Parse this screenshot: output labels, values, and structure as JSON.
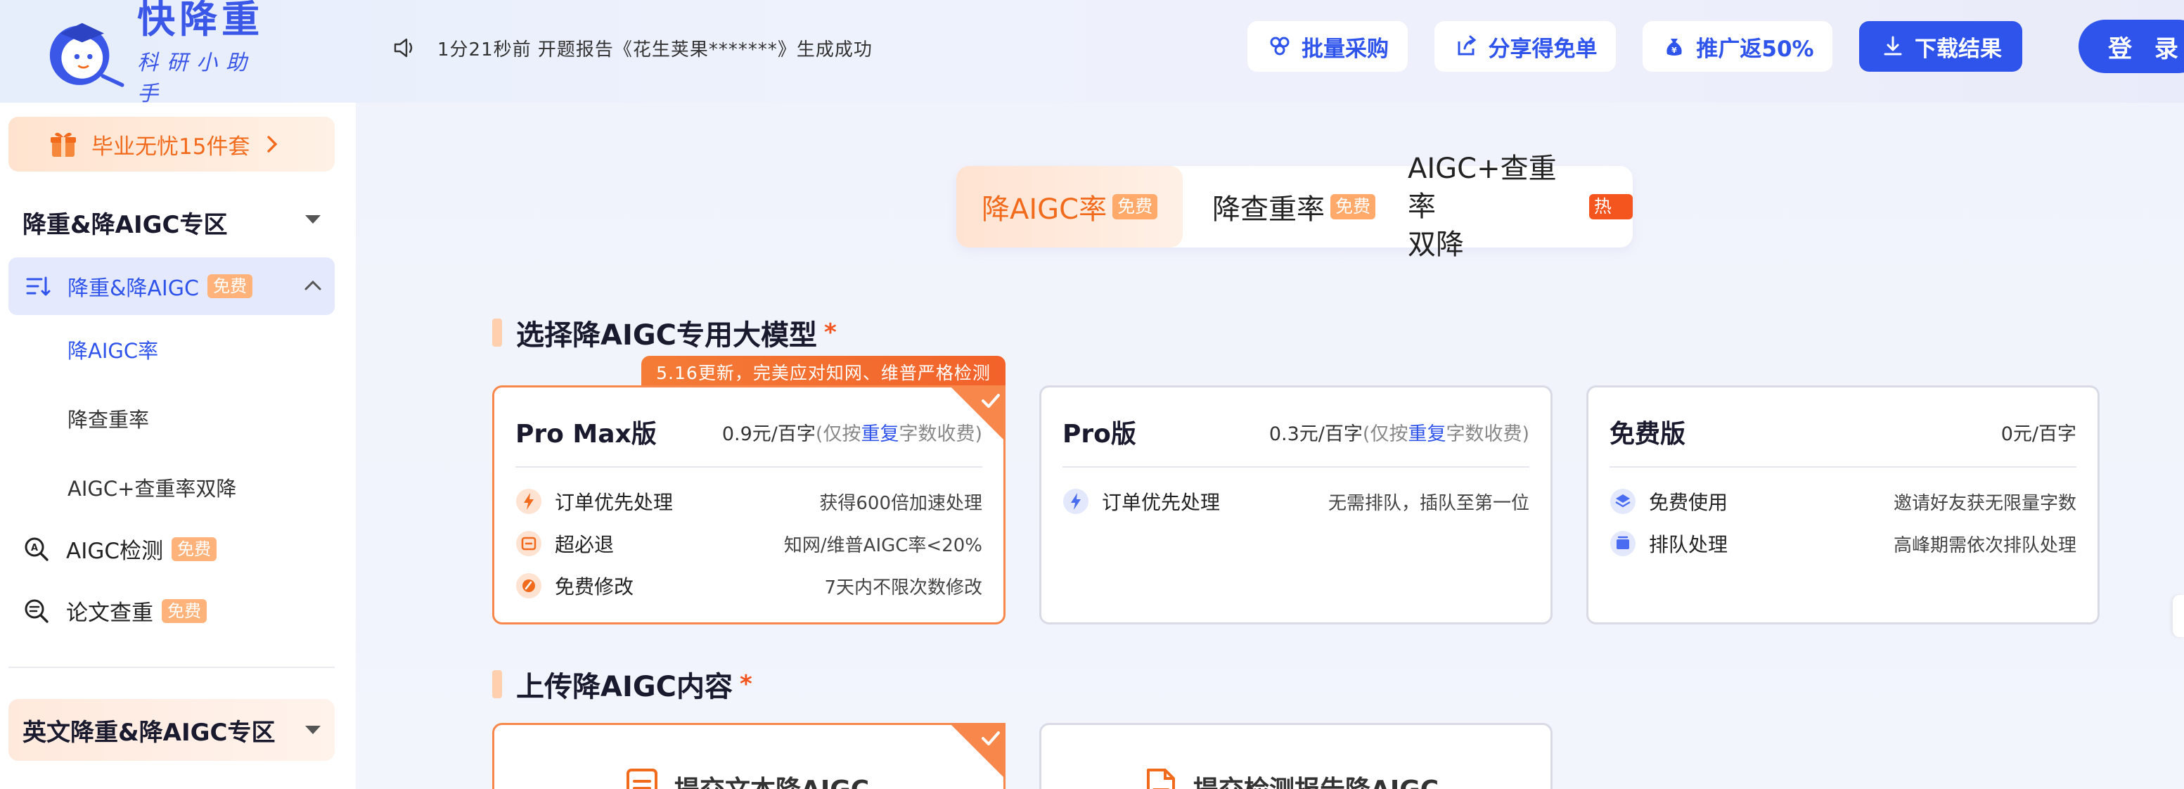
{
  "header": {
    "logo": {
      "title": "快降重",
      "subtitle": "科研小助手"
    },
    "notice": "1分21秒前 开题报告《花生荚果*******》生成成功",
    "buttons": {
      "bulk": "批量采购",
      "share": "分享得免单",
      "promote": "推广返50%",
      "download": "下载结果"
    },
    "login": "登 录"
  },
  "sidebar": {
    "promo": "毕业无忧15件套",
    "group1": "降重&降AIGC专区",
    "active_item": {
      "label": "降重&降AIGC",
      "badge": "免费"
    },
    "sub_items": [
      "降AIGC率",
      "降查重率",
      "AIGC+查重率双降"
    ],
    "items": [
      {
        "label": "AIGC检测",
        "badge": "免费"
      },
      {
        "label": "论文查重",
        "badge": "免费"
      }
    ],
    "group2": "英文降重&降AIGC专区"
  },
  "tabs": [
    {
      "label": "降AIGC率",
      "badge": "免费"
    },
    {
      "label": "降查重率",
      "badge": "免费"
    },
    {
      "label_line1": "AIGC+查重率",
      "label_line2": "双降",
      "badge": "热门"
    }
  ],
  "model_section": {
    "title": "选择降AIGC专用大模型",
    "required_mark": "*",
    "ribbon": "5.16更新，完美应对知网、维普严格检测",
    "cards": [
      {
        "name": "Pro Max版",
        "price": "0.9元/百字",
        "note_prefix": "(仅按",
        "note_em": "重复",
        "note_suffix": "字数收费)",
        "features": [
          {
            "label": "订单优先处理",
            "value": "获得600倍加速处理"
          },
          {
            "label": "超必退",
            "value": "知网/维普AIGC率<20%"
          },
          {
            "label": "免费修改",
            "value": "7天内不限次数修改"
          }
        ]
      },
      {
        "name": "Pro版",
        "price": "0.3元/百字",
        "note_prefix": "(仅按",
        "note_em": "重复",
        "note_suffix": "字数收费)",
        "features": [
          {
            "label": "订单优先处理",
            "value": "无需排队，插队至第一位"
          }
        ]
      },
      {
        "name": "免费版",
        "price": "0元/百字",
        "features": [
          {
            "label": "免费使用",
            "value": "邀请好友获无限量字数"
          },
          {
            "label": "排队处理",
            "value": "高峰期需依次排队处理"
          }
        ]
      }
    ]
  },
  "upload_section": {
    "title": "上传降AIGC内容",
    "required_mark": "*",
    "options": [
      "提交文本降AIGC",
      "提交检测报告降AIGC"
    ]
  },
  "colors": {
    "brand_blue": "#2f54eb",
    "accent_orange": "#f26b1d",
    "badge_orange": "#ffa96b",
    "hot_red": "#f4551e"
  }
}
